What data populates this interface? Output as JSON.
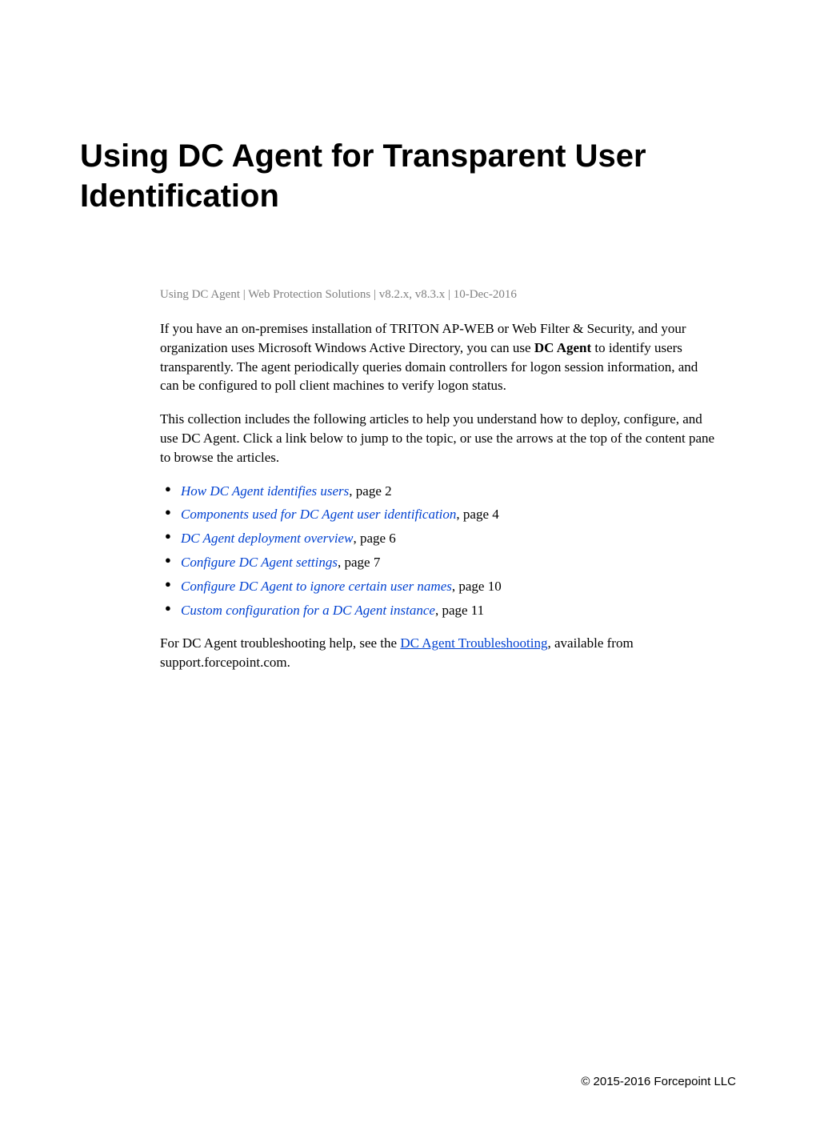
{
  "title": "Using DC Agent for Transparent User Identification",
  "subtitle": "Using DC Agent | Web Protection Solutions | v8.2.x, v8.3.x | 10-Dec-2016",
  "paragraph1_a": "If you have an on-premises installation of TRITON AP-WEB or Web Filter & Security, and your organization uses Microsoft Windows Active Directory, you can use ",
  "paragraph1_bold": "DC Agent",
  "paragraph1_b": " to identify users transparently. The agent periodically queries domain controllers for logon session information, and can be configured to poll client machines to verify logon status.",
  "paragraph2": "This collection includes the following articles to help you understand how to deploy, configure, and use DC Agent. Click a link below to jump to the topic, or use the arrows at the top of the content pane to browse the articles.",
  "toc": [
    {
      "link": "How DC Agent identifies users",
      "suffix": ", page 2"
    },
    {
      "link": "Components used for DC Agent user identification",
      "suffix": ", page 4"
    },
    {
      "link": "DC Agent deployment overview",
      "suffix": ", page 6"
    },
    {
      "link": "Configure DC Agent settings",
      "suffix": ", page 7"
    },
    {
      "link": "Configure DC Agent to ignore certain user names",
      "suffix": ", page 10"
    },
    {
      "link": "Custom configuration for a DC Agent instance",
      "suffix": ", page 11"
    }
  ],
  "paragraph3_a": "For DC Agent troubleshooting help, see the ",
  "paragraph3_link": "DC Agent Troubleshooting",
  "paragraph3_b": ", available from support.forcepoint.com.",
  "footer": "© 2015-2016 Forcepoint LLC"
}
